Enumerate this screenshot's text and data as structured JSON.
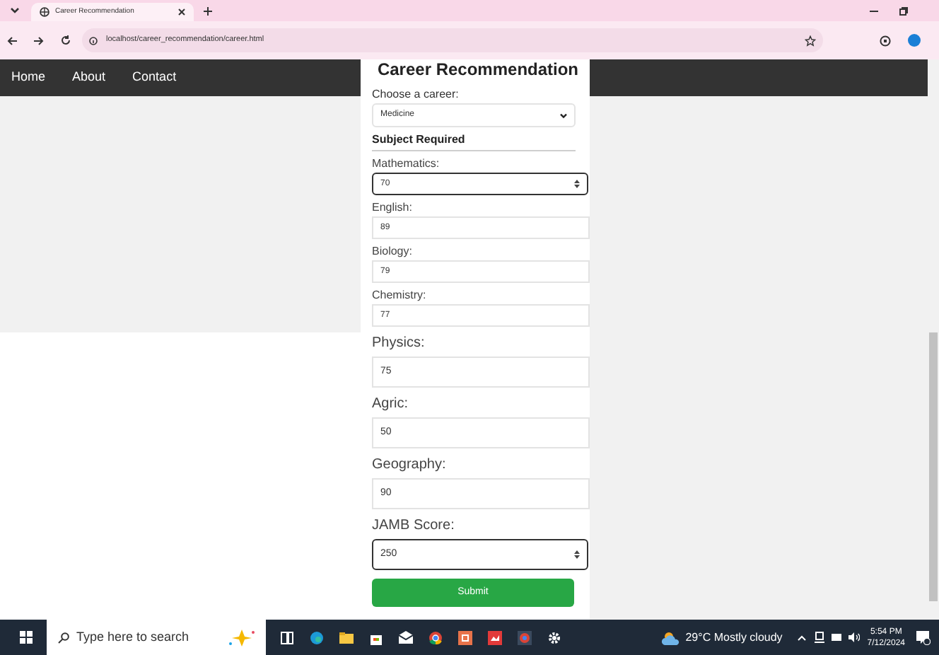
{
  "browser": {
    "tab_title": "Career Recommendation",
    "url": "localhost/career_recommendation/career.html"
  },
  "nav": [
    "Home",
    "About",
    "Contact"
  ],
  "form": {
    "title": "Career Recommendation",
    "career_label": "Choose a career:",
    "career_value": "Medicine",
    "section": "Subject Required",
    "fields": [
      {
        "kind": "compact",
        "label": "Mathematics:",
        "value": "70",
        "focused": true
      },
      {
        "kind": "compact",
        "label": "English:",
        "value": "89",
        "focused": false
      },
      {
        "kind": "compact",
        "label": "Biology:",
        "value": "79",
        "focused": false
      },
      {
        "kind": "compact",
        "label": "Chemistry:",
        "value": "77",
        "focused": false
      },
      {
        "kind": "regular",
        "label": "Physics:",
        "value": "75",
        "focused": false
      },
      {
        "kind": "regular",
        "label": "Agric:",
        "value": "50",
        "focused": false
      },
      {
        "kind": "regular",
        "label": "Geography:",
        "value": "90",
        "focused": false
      },
      {
        "kind": "regular",
        "label": "JAMB Score:",
        "value": "250",
        "focused": true
      }
    ],
    "submit": "Submit"
  },
  "taskbar": {
    "search": "Type here to search",
    "weather": "29°C  Mostly cloudy",
    "time": "5:54 PM",
    "date": "7/12/2024"
  }
}
